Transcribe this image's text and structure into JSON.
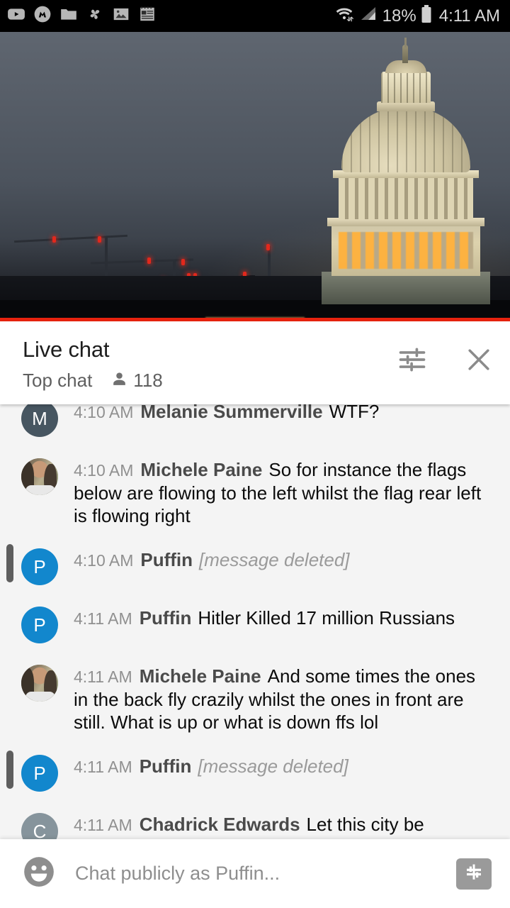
{
  "statusbar": {
    "left_icons": [
      {
        "name": "youtube-icon"
      },
      {
        "name": "messenger-icon"
      },
      {
        "name": "folder-icon"
      },
      {
        "name": "pinwheel-icon"
      },
      {
        "name": "photos-icon"
      },
      {
        "name": "notes-icon"
      }
    ],
    "wifi_icon": "wifi-icon",
    "signal_icon": "cellular-signal-icon",
    "battery_percent": "18%",
    "battery_icon": "battery-icon",
    "time": "4:11 AM"
  },
  "video": {
    "name": "live-video-player",
    "description": "US Capitol dome at dusk",
    "progress_color": "#e8230f"
  },
  "chat_header": {
    "title": "Live chat",
    "mode": "Top chat",
    "viewer_count": "118",
    "people_icon": "person-icon",
    "settings_icon": "tune-icon",
    "close_icon": "close-icon"
  },
  "messages": [
    {
      "time": "4:10 AM",
      "author": "Melanie Summerville",
      "text": "WTF?",
      "deleted": false,
      "avatar": {
        "type": "letter",
        "letter": "M",
        "color": "#475661"
      }
    },
    {
      "time": "4:10 AM",
      "author": "Michele Paine",
      "text": "So for instance the flags below are flowing to the left whilst the flag rear left is flowing right",
      "deleted": false,
      "avatar": {
        "type": "photo",
        "letter": "",
        "color": "#6d7b63"
      }
    },
    {
      "time": "4:10 AM",
      "author": "Puffin",
      "text": "[message deleted]",
      "deleted": true,
      "avatar": {
        "type": "letter",
        "letter": "P",
        "color": "#1287cd"
      }
    },
    {
      "time": "4:11 AM",
      "author": "Puffin",
      "text": "Hitler Killed 17 million Russians",
      "deleted": false,
      "avatar": {
        "type": "letter",
        "letter": "P",
        "color": "#1287cd"
      }
    },
    {
      "time": "4:11 AM",
      "author": "Michele Paine",
      "text": "And some times the ones in the back fly crazily whilst the ones in front are still. What is up or what is down ffs lol",
      "deleted": false,
      "avatar": {
        "type": "photo",
        "letter": "",
        "color": "#6d7b63"
      }
    },
    {
      "time": "4:11 AM",
      "author": "Puffin",
      "text": "[message deleted]",
      "deleted": true,
      "avatar": {
        "type": "letter",
        "letter": "P",
        "color": "#1287cd"
      }
    },
    {
      "time": "4:11 AM",
      "author": "Chadrick Edwards",
      "text": "Let this city be accursed",
      "deleted": false,
      "avatar": {
        "type": "letter",
        "letter": "C",
        "color": "#86949c"
      }
    }
  ],
  "input_bar": {
    "emoji_icon": "emoji-icon",
    "placeholder": "Chat publicly as Puffin...",
    "superchat_icon": "dollar-icon"
  }
}
